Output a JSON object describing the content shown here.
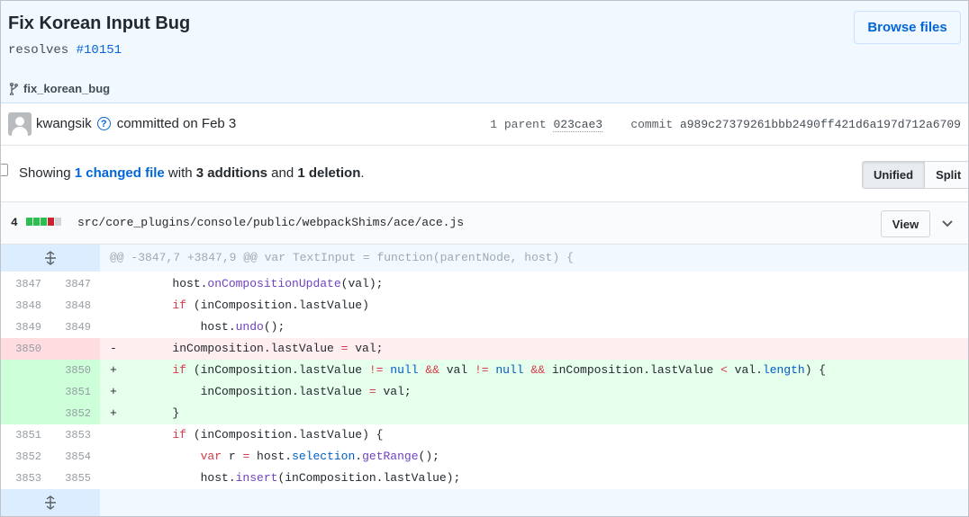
{
  "commit": {
    "title": "Fix Korean Input Bug",
    "description_prefix": "resolves",
    "issue_link": "#10151",
    "browse_files_label": "Browse files",
    "branch": "fix_korean_bug",
    "author": "kwangsik",
    "committed_text": "committed on Feb 3",
    "parents_label": "1 parent",
    "parent_sha": "023cae3",
    "commit_label": "commit",
    "sha": "a989c27379261bbb2490ff421d6a197d712a6709"
  },
  "toc": {
    "showing": "Showing",
    "changed_files": "1 changed file",
    "with": "with",
    "additions": "3 additions",
    "and": "and",
    "deletions": "1 deletion",
    "period": ".",
    "unified_label": "Unified",
    "split_label": "Split"
  },
  "file": {
    "change_count": "4",
    "path": "src/core_plugins/console/public/webpackShims/ace/ace.js",
    "view_label": "View",
    "stat_blocks": [
      "add",
      "add",
      "add",
      "del",
      "neutral"
    ]
  },
  "diff": {
    "hunk_header": "@@ -3847,7 +3847,9 @@ var TextInput = function(parentNode, host) {",
    "lines": [
      {
        "old": "3847",
        "new": "3847",
        "sign": "",
        "type": "ctx"
      },
      {
        "old": "3848",
        "new": "3848",
        "sign": "",
        "type": "ctx"
      },
      {
        "old": "3849",
        "new": "3849",
        "sign": "",
        "type": "ctx"
      },
      {
        "old": "3850",
        "new": "",
        "sign": "-",
        "type": "del"
      },
      {
        "old": "",
        "new": "3850",
        "sign": "+",
        "type": "add"
      },
      {
        "old": "",
        "new": "3851",
        "sign": "+",
        "type": "add"
      },
      {
        "old": "",
        "new": "3852",
        "sign": "+",
        "type": "add"
      },
      {
        "old": "3851",
        "new": "3853",
        "sign": "",
        "type": "ctx"
      },
      {
        "old": "3852",
        "new": "3854",
        "sign": "",
        "type": "ctx"
      },
      {
        "old": "3853",
        "new": "3855",
        "sign": "",
        "type": "ctx"
      }
    ]
  },
  "colors": {
    "link": "#0366d6",
    "add_bg": "#e6ffed",
    "del_bg": "#ffeef0",
    "stat_add": "#2cbe4e",
    "stat_del": "#cb2431"
  }
}
